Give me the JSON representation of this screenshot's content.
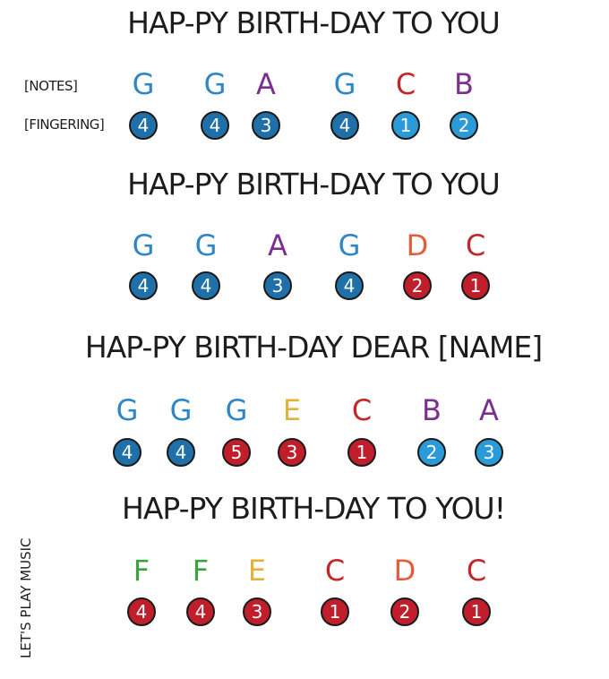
{
  "labels": {
    "notes": "[NOTES]",
    "fingering": "[FINGERING]"
  },
  "side_text": "LET'S PLAY MUSIC",
  "colors": {
    "G": "#2f86c6",
    "A": "#7b2f8e",
    "C": "#c0282a",
    "B": "#7b2f8e",
    "D": "#e45c3a",
    "E": "#e0b43c",
    "F": "#3ba23b",
    "finger_blue": "#1f6fa8",
    "finger_light_blue": "#2b9ad8",
    "finger_red": "#c01e2a"
  },
  "lines": [
    {
      "lyric": "HAP-PY BIRTH-DAY TO YOU",
      "notes": [
        "G",
        "G",
        "A",
        "G",
        "C",
        "B"
      ],
      "fingers": [
        {
          "n": "4",
          "c": "finger_blue"
        },
        {
          "n": "4",
          "c": "finger_blue"
        },
        {
          "n": "3",
          "c": "finger_blue"
        },
        {
          "n": "4",
          "c": "finger_blue"
        },
        {
          "n": "1",
          "c": "finger_light_blue"
        },
        {
          "n": "2",
          "c": "finger_light_blue"
        }
      ]
    },
    {
      "lyric": "HAP-PY BIRTH-DAY TO YOU",
      "notes": [
        "G",
        "G",
        "A",
        "G",
        "D",
        "C"
      ],
      "fingers": [
        {
          "n": "4",
          "c": "finger_blue"
        },
        {
          "n": "4",
          "c": "finger_blue"
        },
        {
          "n": "3",
          "c": "finger_blue"
        },
        {
          "n": "4",
          "c": "finger_blue"
        },
        {
          "n": "2",
          "c": "finger_red"
        },
        {
          "n": "1",
          "c": "finger_red"
        }
      ]
    },
    {
      "lyric": "HAP-PY BIRTH-DAY DEAR [NAME]",
      "notes": [
        "G",
        "G",
        "G",
        "E",
        "C",
        "B",
        "A"
      ],
      "fingers": [
        {
          "n": "4",
          "c": "finger_blue"
        },
        {
          "n": "4",
          "c": "finger_blue"
        },
        {
          "n": "5",
          "c": "finger_red"
        },
        {
          "n": "3",
          "c": "finger_red"
        },
        {
          "n": "1",
          "c": "finger_red"
        },
        {
          "n": "2",
          "c": "finger_light_blue"
        },
        {
          "n": "3",
          "c": "finger_light_blue"
        }
      ]
    },
    {
      "lyric": "HAP-PY BIRTH-DAY TO YOU!",
      "notes": [
        "F",
        "F",
        "E",
        "C",
        "D",
        "C"
      ],
      "fingers": [
        {
          "n": "4",
          "c": "finger_red"
        },
        {
          "n": "4",
          "c": "finger_red"
        },
        {
          "n": "3",
          "c": "finger_red"
        },
        {
          "n": "1",
          "c": "finger_red"
        },
        {
          "n": "2",
          "c": "finger_red"
        },
        {
          "n": "1",
          "c": "finger_red"
        }
      ]
    }
  ]
}
